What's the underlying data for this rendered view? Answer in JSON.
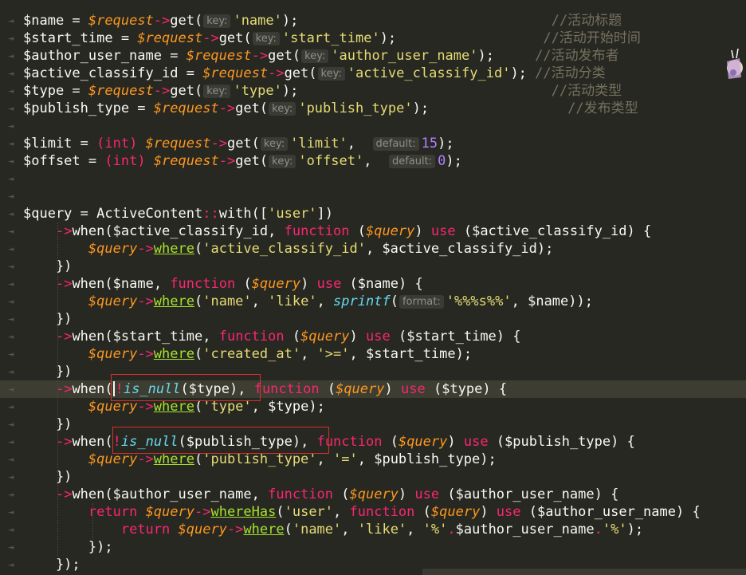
{
  "editor": {
    "lines": [
      [
        {
          "t": "$name",
          "c": "v"
        },
        {
          "t": " = ",
          "c": "v"
        },
        {
          "t": "$request",
          "c": "vi"
        },
        {
          "t": "->",
          "c": "op"
        },
        {
          "t": "get",
          "c": "v"
        },
        {
          "t": "(",
          "c": "v"
        },
        {
          "t": "key:",
          "c": "hint"
        },
        {
          "t": "'name'",
          "c": "s"
        },
        {
          "t": ");",
          "c": "v"
        },
        {
          "t": "                               //活动标题",
          "c": "c"
        }
      ],
      [
        {
          "t": "$start_time",
          "c": "v"
        },
        {
          "t": " = ",
          "c": "v"
        },
        {
          "t": "$request",
          "c": "vi"
        },
        {
          "t": "->",
          "c": "op"
        },
        {
          "t": "get",
          "c": "v"
        },
        {
          "t": "(",
          "c": "v"
        },
        {
          "t": "key:",
          "c": "hint"
        },
        {
          "t": "'start_time'",
          "c": "s"
        },
        {
          "t": ");",
          "c": "v"
        },
        {
          "t": "                  //活动开始时间",
          "c": "c"
        }
      ],
      [
        {
          "t": "$author_user_name",
          "c": "v"
        },
        {
          "t": " = ",
          "c": "v"
        },
        {
          "t": "$request",
          "c": "vi"
        },
        {
          "t": "->",
          "c": "op"
        },
        {
          "t": "get",
          "c": "v"
        },
        {
          "t": "(",
          "c": "v"
        },
        {
          "t": "key:",
          "c": "hint"
        },
        {
          "t": "'author_user_name'",
          "c": "s"
        },
        {
          "t": ");",
          "c": "v"
        },
        {
          "t": "     //活动发布者",
          "c": "c"
        }
      ],
      [
        {
          "t": "$active_classify_id",
          "c": "v"
        },
        {
          "t": " = ",
          "c": "v"
        },
        {
          "t": "$request",
          "c": "vi"
        },
        {
          "t": "->",
          "c": "op"
        },
        {
          "t": "get",
          "c": "v"
        },
        {
          "t": "(",
          "c": "v"
        },
        {
          "t": "key:",
          "c": "hint"
        },
        {
          "t": "'active_classify_id'",
          "c": "s"
        },
        {
          "t": "); ",
          "c": "v"
        },
        {
          "t": "//活动分类",
          "c": "c"
        }
      ],
      [
        {
          "t": "$type",
          "c": "v"
        },
        {
          "t": " = ",
          "c": "v"
        },
        {
          "t": "$request",
          "c": "vi"
        },
        {
          "t": "->",
          "c": "op"
        },
        {
          "t": "get",
          "c": "v"
        },
        {
          "t": "(",
          "c": "v"
        },
        {
          "t": "key:",
          "c": "hint"
        },
        {
          "t": "'type'",
          "c": "s"
        },
        {
          "t": ");",
          "c": "v"
        },
        {
          "t": "                               //活动类型",
          "c": "c"
        }
      ],
      [
        {
          "t": "$publish_type",
          "c": "v"
        },
        {
          "t": " = ",
          "c": "v"
        },
        {
          "t": "$request",
          "c": "vi"
        },
        {
          "t": "->",
          "c": "op"
        },
        {
          "t": "get",
          "c": "v"
        },
        {
          "t": "(",
          "c": "v"
        },
        {
          "t": "key:",
          "c": "hint"
        },
        {
          "t": "'publish_type'",
          "c": "s"
        },
        {
          "t": ");",
          "c": "v"
        },
        {
          "t": "                 //发布类型",
          "c": "c"
        }
      ],
      [],
      [
        {
          "t": "$limit",
          "c": "v"
        },
        {
          "t": " = ",
          "c": "v"
        },
        {
          "t": "(int)",
          "c": "op"
        },
        {
          "t": " ",
          "c": "v"
        },
        {
          "t": "$request",
          "c": "vi"
        },
        {
          "t": "->",
          "c": "op"
        },
        {
          "t": "get",
          "c": "v"
        },
        {
          "t": "(",
          "c": "v"
        },
        {
          "t": "key:",
          "c": "hint"
        },
        {
          "t": "'limit'",
          "c": "s"
        },
        {
          "t": ",  ",
          "c": "v"
        },
        {
          "t": "default:",
          "c": "hint"
        },
        {
          "t": "15",
          "c": "n"
        },
        {
          "t": ");",
          "c": "v"
        }
      ],
      [
        {
          "t": "$offset",
          "c": "v"
        },
        {
          "t": " = ",
          "c": "v"
        },
        {
          "t": "(int)",
          "c": "op"
        },
        {
          "t": " ",
          "c": "v"
        },
        {
          "t": "$request",
          "c": "vi"
        },
        {
          "t": "->",
          "c": "op"
        },
        {
          "t": "get",
          "c": "v"
        },
        {
          "t": "(",
          "c": "v"
        },
        {
          "t": "key:",
          "c": "hint"
        },
        {
          "t": "'offset'",
          "c": "s"
        },
        {
          "t": ",  ",
          "c": "v"
        },
        {
          "t": "default:",
          "c": "hint"
        },
        {
          "t": "0",
          "c": "n"
        },
        {
          "t": ");",
          "c": "v"
        }
      ],
      [],
      [],
      [
        {
          "t": "$query",
          "c": "v"
        },
        {
          "t": " = ",
          "c": "v"
        },
        {
          "t": "ActiveContent",
          "c": "v"
        },
        {
          "t": "::",
          "c": "op"
        },
        {
          "t": "with",
          "c": "v"
        },
        {
          "t": "([",
          "c": "v"
        },
        {
          "t": "'user'",
          "c": "s"
        },
        {
          "t": "])",
          "c": "v"
        }
      ],
      [
        {
          "t": "    ",
          "c": "v"
        },
        {
          "t": "->",
          "c": "op"
        },
        {
          "t": "when",
          "c": "v"
        },
        {
          "t": "(",
          "c": "v"
        },
        {
          "t": "$active_classify_id",
          "c": "v"
        },
        {
          "t": ", ",
          "c": "v"
        },
        {
          "t": "function",
          "c": "kw"
        },
        {
          "t": " (",
          "c": "v"
        },
        {
          "t": "$query",
          "c": "vi"
        },
        {
          "t": ") ",
          "c": "v"
        },
        {
          "t": "use",
          "c": "kw"
        },
        {
          "t": " (",
          "c": "v"
        },
        {
          "t": "$active_classify_id",
          "c": "v"
        },
        {
          "t": ") {",
          "c": "v"
        }
      ],
      [
        {
          "t": "        ",
          "c": "v"
        },
        {
          "t": "$query",
          "c": "vi"
        },
        {
          "t": "->",
          "c": "op"
        },
        {
          "t": "where",
          "c": "fn u"
        },
        {
          "t": "(",
          "c": "v"
        },
        {
          "t": "'active_classify_id'",
          "c": "s"
        },
        {
          "t": ", ",
          "c": "v"
        },
        {
          "t": "$active_classify_id",
          "c": "v"
        },
        {
          "t": ");",
          "c": "v"
        }
      ],
      [
        {
          "t": "    })",
          "c": "v"
        }
      ],
      [
        {
          "t": "    ",
          "c": "v"
        },
        {
          "t": "->",
          "c": "op"
        },
        {
          "t": "when",
          "c": "v"
        },
        {
          "t": "(",
          "c": "v"
        },
        {
          "t": "$name",
          "c": "v"
        },
        {
          "t": ", ",
          "c": "v"
        },
        {
          "t": "function",
          "c": "kw"
        },
        {
          "t": " (",
          "c": "v"
        },
        {
          "t": "$query",
          "c": "vi"
        },
        {
          "t": ") ",
          "c": "v"
        },
        {
          "t": "use",
          "c": "kw"
        },
        {
          "t": " (",
          "c": "v"
        },
        {
          "t": "$name",
          "c": "v"
        },
        {
          "t": ") {",
          "c": "v"
        }
      ],
      [
        {
          "t": "        ",
          "c": "v"
        },
        {
          "t": "$query",
          "c": "vi"
        },
        {
          "t": "->",
          "c": "op"
        },
        {
          "t": "where",
          "c": "fn u"
        },
        {
          "t": "(",
          "c": "v"
        },
        {
          "t": "'name'",
          "c": "s"
        },
        {
          "t": ", ",
          "c": "v"
        },
        {
          "t": "'like'",
          "c": "s"
        },
        {
          "t": ", ",
          "c": "v"
        },
        {
          "t": "sprintf",
          "c": "fni"
        },
        {
          "t": "(",
          "c": "v"
        },
        {
          "t": "format:",
          "c": "hint"
        },
        {
          "t": "'%%%s%%'",
          "c": "s"
        },
        {
          "t": ", ",
          "c": "v"
        },
        {
          "t": "$name",
          "c": "v"
        },
        {
          "t": "));",
          "c": "v"
        }
      ],
      [
        {
          "t": "    })",
          "c": "v"
        }
      ],
      [
        {
          "t": "    ",
          "c": "v"
        },
        {
          "t": "->",
          "c": "op"
        },
        {
          "t": "when",
          "c": "v"
        },
        {
          "t": "(",
          "c": "v"
        },
        {
          "t": "$start_time",
          "c": "v"
        },
        {
          "t": ", ",
          "c": "v"
        },
        {
          "t": "function",
          "c": "kw"
        },
        {
          "t": " (",
          "c": "v"
        },
        {
          "t": "$query",
          "c": "vi"
        },
        {
          "t": ") ",
          "c": "v"
        },
        {
          "t": "use",
          "c": "kw"
        },
        {
          "t": " (",
          "c": "v"
        },
        {
          "t": "$start_time",
          "c": "v"
        },
        {
          "t": ") {",
          "c": "v"
        }
      ],
      [
        {
          "t": "        ",
          "c": "v"
        },
        {
          "t": "$query",
          "c": "vi"
        },
        {
          "t": "->",
          "c": "op"
        },
        {
          "t": "where",
          "c": "fn u"
        },
        {
          "t": "(",
          "c": "v"
        },
        {
          "t": "'created_at'",
          "c": "s"
        },
        {
          "t": ", ",
          "c": "v"
        },
        {
          "t": "'>='",
          "c": "s"
        },
        {
          "t": ", ",
          "c": "v"
        },
        {
          "t": "$start_time",
          "c": "v"
        },
        {
          "t": ");",
          "c": "v"
        }
      ],
      [
        {
          "t": "    })",
          "c": "v"
        }
      ],
      [
        {
          "t": "    ",
          "c": "v"
        },
        {
          "t": "->",
          "c": "op"
        },
        {
          "t": "when",
          "c": "v"
        },
        {
          "t": "(",
          "c": "v"
        },
        {
          "t": "",
          "c": "cursor"
        },
        {
          "t": "!",
          "c": "op"
        },
        {
          "t": "is_null",
          "c": "fni"
        },
        {
          "t": "(",
          "c": "v"
        },
        {
          "t": "$type",
          "c": "v"
        },
        {
          "t": "), ",
          "c": "v"
        },
        {
          "t": "function",
          "c": "kw"
        },
        {
          "t": " (",
          "c": "v"
        },
        {
          "t": "$query",
          "c": "vi"
        },
        {
          "t": ") ",
          "c": "v"
        },
        {
          "t": "use",
          "c": "kw"
        },
        {
          "t": " (",
          "c": "v"
        },
        {
          "t": "$type",
          "c": "v"
        },
        {
          "t": ") {",
          "c": "v"
        }
      ],
      [
        {
          "t": "        ",
          "c": "v"
        },
        {
          "t": "$query",
          "c": "vi"
        },
        {
          "t": "->",
          "c": "op"
        },
        {
          "t": "where",
          "c": "fn u"
        },
        {
          "t": "(",
          "c": "v"
        },
        {
          "t": "'type'",
          "c": "s"
        },
        {
          "t": ", ",
          "c": "v"
        },
        {
          "t": "$type",
          "c": "v"
        },
        {
          "t": ");",
          "c": "v"
        }
      ],
      [
        {
          "t": "    })",
          "c": "v"
        }
      ],
      [
        {
          "t": "    ",
          "c": "v"
        },
        {
          "t": "->",
          "c": "op"
        },
        {
          "t": "when",
          "c": "v"
        },
        {
          "t": "(",
          "c": "v"
        },
        {
          "t": "!",
          "c": "op"
        },
        {
          "t": "is_null",
          "c": "fni"
        },
        {
          "t": "(",
          "c": "v"
        },
        {
          "t": "$publish_type",
          "c": "v"
        },
        {
          "t": "), ",
          "c": "v"
        },
        {
          "t": "function",
          "c": "kw"
        },
        {
          "t": " (",
          "c": "v"
        },
        {
          "t": "$query",
          "c": "vi"
        },
        {
          "t": ") ",
          "c": "v"
        },
        {
          "t": "use",
          "c": "kw"
        },
        {
          "t": " (",
          "c": "v"
        },
        {
          "t": "$publish_type",
          "c": "v"
        },
        {
          "t": ") {",
          "c": "v"
        }
      ],
      [
        {
          "t": "        ",
          "c": "v"
        },
        {
          "t": "$query",
          "c": "vi"
        },
        {
          "t": "->",
          "c": "op"
        },
        {
          "t": "where",
          "c": "fn u"
        },
        {
          "t": "(",
          "c": "v"
        },
        {
          "t": "'publish_type'",
          "c": "s"
        },
        {
          "t": ", ",
          "c": "v"
        },
        {
          "t": "'='",
          "c": "s"
        },
        {
          "t": ", ",
          "c": "v"
        },
        {
          "t": "$publish_type",
          "c": "v"
        },
        {
          "t": ");",
          "c": "v"
        }
      ],
      [
        {
          "t": "    })",
          "c": "v"
        }
      ],
      [
        {
          "t": "    ",
          "c": "v"
        },
        {
          "t": "->",
          "c": "op"
        },
        {
          "t": "when",
          "c": "v"
        },
        {
          "t": "(",
          "c": "v"
        },
        {
          "t": "$author_user_name",
          "c": "v"
        },
        {
          "t": ", ",
          "c": "v"
        },
        {
          "t": "function",
          "c": "kw"
        },
        {
          "t": " (",
          "c": "v"
        },
        {
          "t": "$query",
          "c": "vi"
        },
        {
          "t": ") ",
          "c": "v"
        },
        {
          "t": "use",
          "c": "kw"
        },
        {
          "t": " (",
          "c": "v"
        },
        {
          "t": "$author_user_name",
          "c": "v"
        },
        {
          "t": ") {",
          "c": "v"
        }
      ],
      [
        {
          "t": "        ",
          "c": "v"
        },
        {
          "t": "return",
          "c": "kw"
        },
        {
          "t": " ",
          "c": "v"
        },
        {
          "t": "$query",
          "c": "vi"
        },
        {
          "t": "->",
          "c": "op"
        },
        {
          "t": "whereHas",
          "c": "fn u"
        },
        {
          "t": "(",
          "c": "v"
        },
        {
          "t": "'user'",
          "c": "s"
        },
        {
          "t": ", ",
          "c": "v"
        },
        {
          "t": "function",
          "c": "kw"
        },
        {
          "t": " (",
          "c": "v"
        },
        {
          "t": "$query",
          "c": "vi"
        },
        {
          "t": ") ",
          "c": "v"
        },
        {
          "t": "use",
          "c": "kw"
        },
        {
          "t": " (",
          "c": "v"
        },
        {
          "t": "$author_user_name",
          "c": "v"
        },
        {
          "t": ") {",
          "c": "v"
        }
      ],
      [
        {
          "t": "            ",
          "c": "v"
        },
        {
          "t": "return",
          "c": "kw"
        },
        {
          "t": " ",
          "c": "v"
        },
        {
          "t": "$query",
          "c": "vi"
        },
        {
          "t": "->",
          "c": "op"
        },
        {
          "t": "where",
          "c": "fn u"
        },
        {
          "t": "(",
          "c": "v"
        },
        {
          "t": "'name'",
          "c": "s"
        },
        {
          "t": ", ",
          "c": "v"
        },
        {
          "t": "'like'",
          "c": "s"
        },
        {
          "t": ", ",
          "c": "v"
        },
        {
          "t": "'%'",
          "c": "s"
        },
        {
          "t": ".",
          "c": "op"
        },
        {
          "t": "$author_user_name",
          "c": "v"
        },
        {
          "t": ".",
          "c": "op"
        },
        {
          "t": "'%'",
          "c": "s"
        },
        {
          "t": ");",
          "c": "v"
        }
      ],
      [
        {
          "t": "        });",
          "c": "v"
        }
      ],
      [
        {
          "t": "    });",
          "c": "v"
        }
      ]
    ],
    "active_line": 21
  },
  "colors": {
    "background": "#272822",
    "active_line": "#3e3d32",
    "highlight_box": "#d9302c"
  }
}
